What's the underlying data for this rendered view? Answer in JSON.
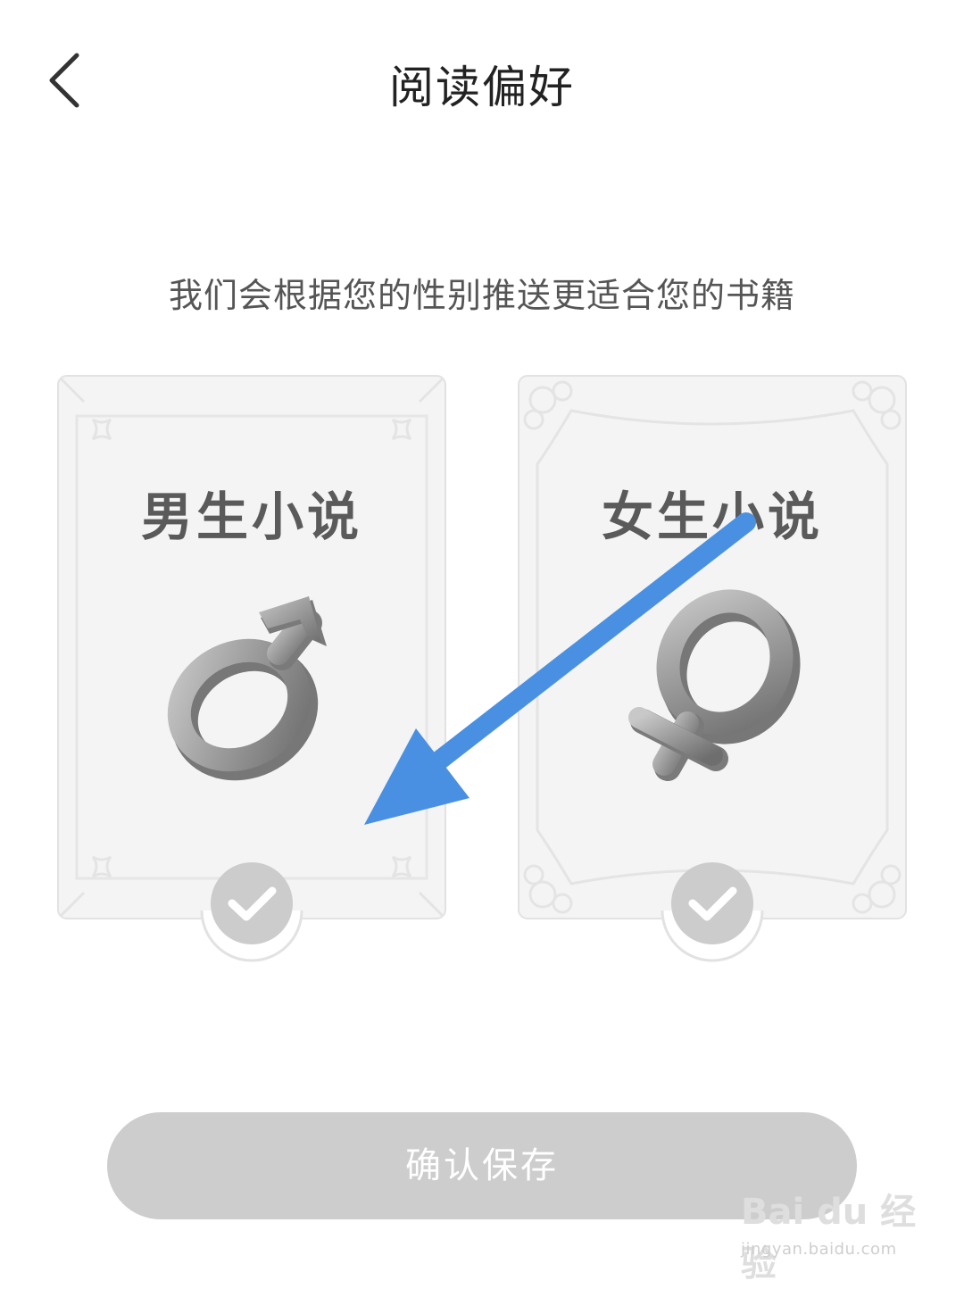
{
  "header": {
    "back_icon": "chevron-left-icon",
    "title": "阅读偏好"
  },
  "main": {
    "subtitle": "我们会根据您的性别推送更适合您的书籍",
    "cards": [
      {
        "label": "男生小说",
        "symbol_icon": "male-symbol-icon",
        "selected": false
      },
      {
        "label": "女生小说",
        "symbol_icon": "female-symbol-icon",
        "selected": false
      }
    ]
  },
  "footer": {
    "save_label": "确认保存",
    "save_enabled": false
  },
  "watermark": {
    "logo_text": "Bai du 经验",
    "url": "jingyan.baidu.com"
  },
  "colors": {
    "card_background": "#f4f4f4",
    "card_border": "#e2e2e2",
    "check_circle": "#cccccc",
    "button_disabled": "#cdcdcd",
    "annotation_arrow": "#4a90e2"
  }
}
